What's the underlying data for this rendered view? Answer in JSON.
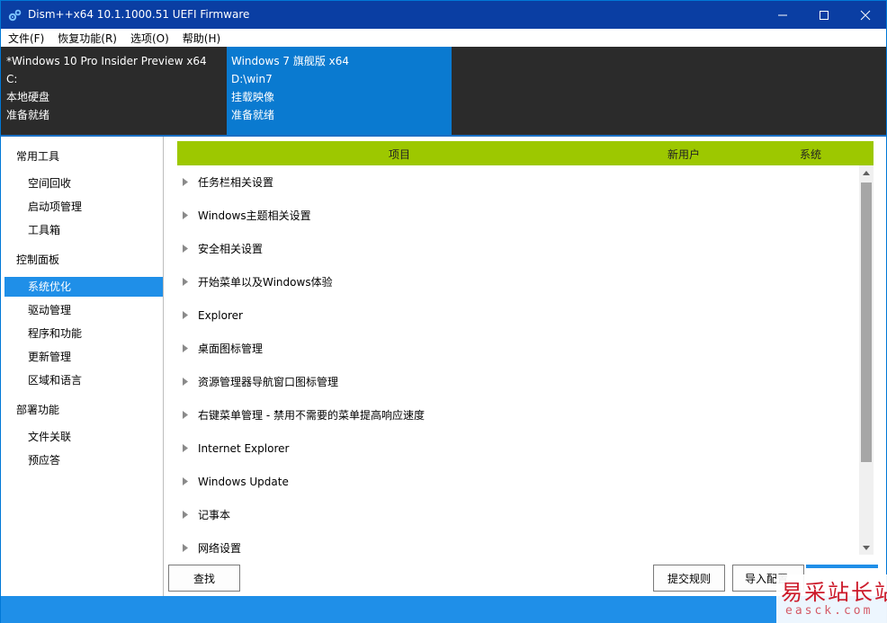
{
  "window": {
    "title": "Dism++x64 10.1.1000.51 UEFI Firmware",
    "icons": {
      "app": "gear-icon",
      "minimize": "minimize-icon",
      "maximize": "maximize-icon",
      "close": "close-icon"
    }
  },
  "menu": {
    "items": [
      {
        "label": "文件(F)"
      },
      {
        "label": "恢复功能(R)"
      },
      {
        "label": "选项(O)"
      },
      {
        "label": "帮助(H)"
      }
    ]
  },
  "images": [
    {
      "name": "*Windows 10 Pro Insider Preview x64",
      "path": "C:",
      "type": "本地硬盘",
      "status": "准备就绪",
      "selected": false
    },
    {
      "name": "Windows 7 旗舰版 x64",
      "path": "D:\\win7",
      "type": "挂载映像",
      "status": "准备就绪",
      "selected": true
    }
  ],
  "sidebar": {
    "groups": [
      {
        "title": "常用工具",
        "items": [
          {
            "label": "空间回收"
          },
          {
            "label": "启动项管理"
          },
          {
            "label": "工具箱"
          }
        ]
      },
      {
        "title": "控制面板",
        "items": [
          {
            "label": "系统优化",
            "active": true
          },
          {
            "label": "驱动管理"
          },
          {
            "label": "程序和功能"
          },
          {
            "label": "更新管理"
          },
          {
            "label": "区域和语言"
          }
        ]
      },
      {
        "title": "部署功能",
        "items": [
          {
            "label": "文件关联"
          },
          {
            "label": "预应答"
          }
        ]
      }
    ]
  },
  "table": {
    "columns": {
      "item": "项目",
      "new_user": "新用户",
      "system": "系统"
    },
    "rows": [
      {
        "label": "任务栏相关设置"
      },
      {
        "label": "Windows主题相关设置"
      },
      {
        "label": "安全相关设置"
      },
      {
        "label": "开始菜单以及Windows体验"
      },
      {
        "label": "Explorer"
      },
      {
        "label": "桌面图标管理"
      },
      {
        "label": "资源管理器导航窗口图标管理"
      },
      {
        "label": "右键菜单管理 - 禁用不需要的菜单提高响应速度"
      },
      {
        "label": "Internet Explorer"
      },
      {
        "label": "Windows Update"
      },
      {
        "label": "记事本"
      },
      {
        "label": "网络设置"
      }
    ]
  },
  "buttons": {
    "find": "查找",
    "submit_rules": "提交规则",
    "import_config": "导入配置"
  },
  "watermark": {
    "text": "易采站长站",
    "url": "easck.com"
  },
  "colors": {
    "titlebar": "#0a3ea3",
    "accent": "#1f8fe8",
    "selected_image": "#0a7ad0",
    "header_green": "#9dc800",
    "dark_panel": "#2b2b2b"
  }
}
